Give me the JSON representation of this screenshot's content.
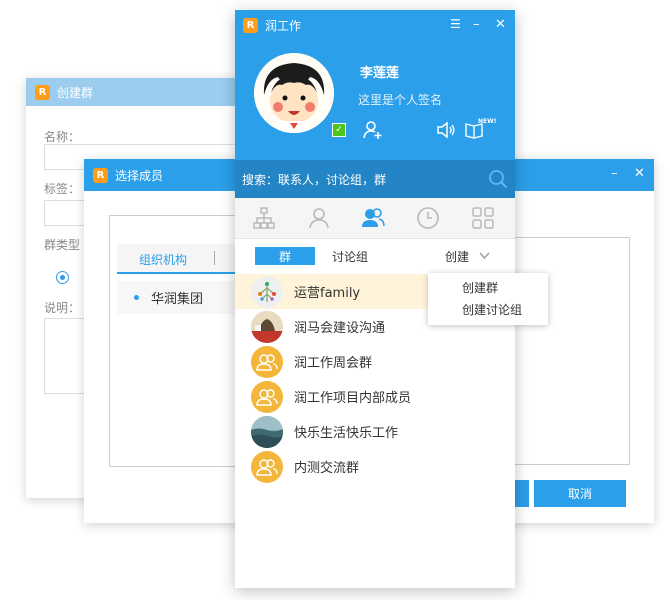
{
  "create_group": {
    "title": "创建群",
    "name_label": "名称：",
    "tag_label": "标签：",
    "type_label": "群类型",
    "desc_label": "说明："
  },
  "select_members": {
    "title": "选择成员",
    "tab_org": "组织机构",
    "org_item": "华润集团",
    "cancel": "取消"
  },
  "main": {
    "title": "润工作",
    "user": {
      "name": "李莲莲",
      "signature": "这里是个人签名"
    },
    "badge_new": "NEW!",
    "search_placeholder": "搜索：联系人，讨论组，群",
    "subtabs": {
      "group": "群",
      "discussion": "讨论组",
      "create": "创建"
    },
    "create_menu": [
      "创建群",
      "创建讨论组"
    ],
    "groups": [
      {
        "name": "运营family"
      },
      {
        "name": "润马会建设沟通"
      },
      {
        "name": "润工作周会群"
      },
      {
        "name": "润工作项目内部成员"
      },
      {
        "name": "快乐生活快乐工作"
      },
      {
        "name": "内测交流群"
      }
    ]
  },
  "colors": {
    "primary": "#2b9fea",
    "selected_row": "#fff3d9",
    "group_avatar": "#f3b63a"
  }
}
